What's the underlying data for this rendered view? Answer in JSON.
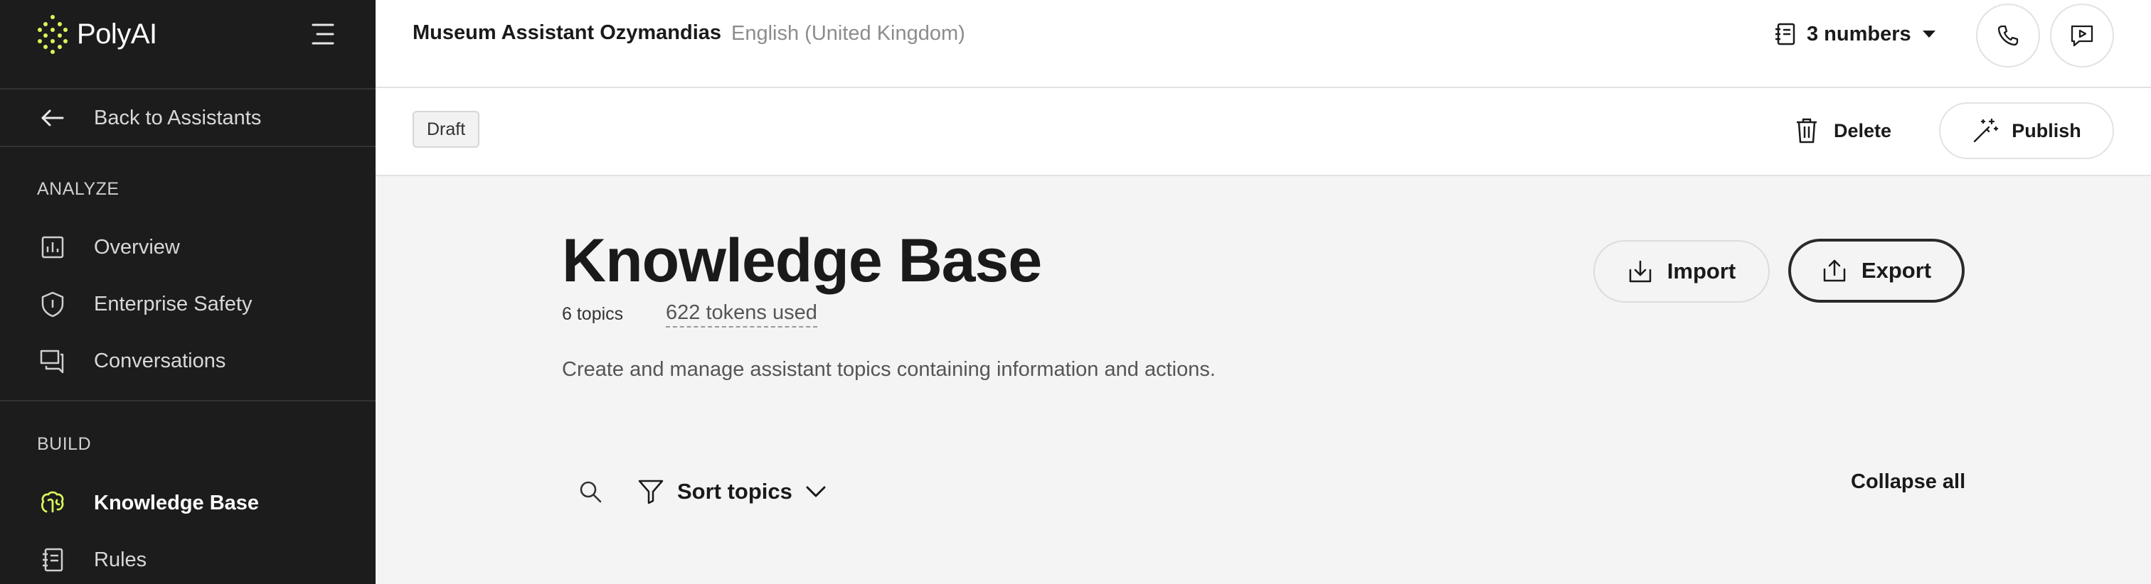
{
  "app": {
    "logo_text": "PolyAI"
  },
  "sidebar": {
    "back_label": "Back to Assistants",
    "analyze_label": "ANALYZE",
    "build_label": "BUILD",
    "analyze_items": [
      {
        "label": "Overview",
        "icon": "bar-chart-icon"
      },
      {
        "label": "Enterprise Safety",
        "icon": "shield-icon"
      },
      {
        "label": "Conversations",
        "icon": "chat-icon"
      }
    ],
    "build_items": [
      {
        "label": "Knowledge Base",
        "icon": "brain-icon",
        "active": true
      },
      {
        "label": "Rules",
        "icon": "notebook-icon"
      }
    ],
    "active_icon_color": "#d7f55a"
  },
  "header": {
    "assistant_name": "Museum Assistant Ozymandias",
    "language": "English (United Kingdom)",
    "numbers_label": "3 numbers"
  },
  "subheader": {
    "status_badge": "Draft",
    "delete_label": "Delete",
    "publish_label": "Publish"
  },
  "main": {
    "title": "Knowledge Base",
    "topics_count": "6 topics",
    "tokens_used": "622 tokens used",
    "description": "Create and manage assistant topics containing information and actions.",
    "import_label": "Import",
    "export_label": "Export",
    "sort_label": "Sort topics",
    "collapse_all_label": "Collapse all"
  }
}
